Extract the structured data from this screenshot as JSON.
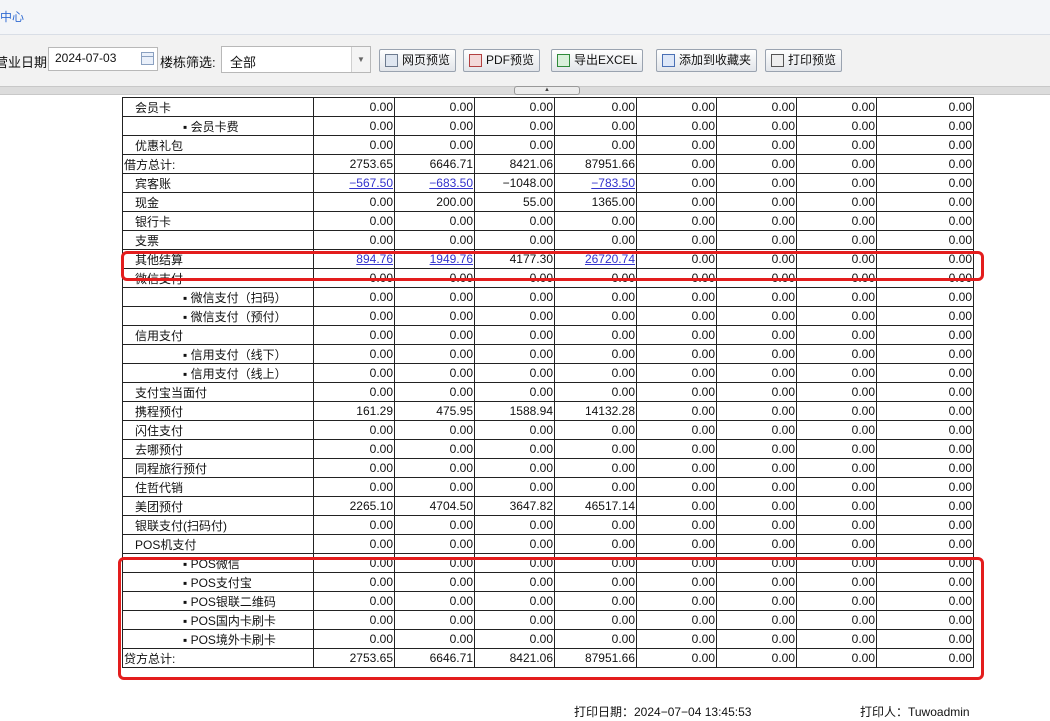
{
  "header": {
    "active_tab": "中心"
  },
  "toolbar": {
    "date_label": "营业日期",
    "date_value": "2024-07-03",
    "building_label": "楼栋筛选:",
    "building_value": "全部",
    "buttons": [
      "网页预览",
      "PDF预览",
      "导出EXCEL",
      "添加到收藏夹",
      "打印预览"
    ]
  },
  "table": {
    "rows": [
      {
        "name": "会员卡",
        "level": 1,
        "values": [
          "0.00",
          "0.00",
          "0.00",
          "0.00",
          "0.00",
          "0.00",
          "0.00",
          "0.00"
        ]
      },
      {
        "name": "▪ 会员卡费",
        "level": 2,
        "values": [
          "0.00",
          "0.00",
          "0.00",
          "0.00",
          "0.00",
          "0.00",
          "0.00",
          "0.00"
        ]
      },
      {
        "name": "优惠礼包",
        "level": 1,
        "values": [
          "0.00",
          "0.00",
          "0.00",
          "0.00",
          "0.00",
          "0.00",
          "0.00",
          "0.00"
        ]
      },
      {
        "name": "借方总计:",
        "level": 0,
        "values": [
          "2753.65",
          "6646.71",
          "8421.06",
          "87951.66",
          "0.00",
          "0.00",
          "0.00",
          "0.00"
        ]
      },
      {
        "name": "宾客账",
        "level": 1,
        "values": [
          "−567.50",
          "−683.50",
          "−1048.00",
          "−783.50",
          "0.00",
          "0.00",
          "0.00",
          "0.00"
        ],
        "links": [
          0,
          1,
          3
        ]
      },
      {
        "name": "现金",
        "level": 1,
        "values": [
          "0.00",
          "200.00",
          "55.00",
          "1365.00",
          "0.00",
          "0.00",
          "0.00",
          "0.00"
        ]
      },
      {
        "name": "银行卡",
        "level": 1,
        "values": [
          "0.00",
          "0.00",
          "0.00",
          "0.00",
          "0.00",
          "0.00",
          "0.00",
          "0.00"
        ]
      },
      {
        "name": "支票",
        "level": 1,
        "values": [
          "0.00",
          "0.00",
          "0.00",
          "0.00",
          "0.00",
          "0.00",
          "0.00",
          "0.00"
        ]
      },
      {
        "name": "其他结算",
        "level": 1,
        "values": [
          "894.76",
          "1949.76",
          "4177.30",
          "26720.74",
          "0.00",
          "0.00",
          "0.00",
          "0.00"
        ],
        "links": [
          0,
          1,
          3
        ]
      },
      {
        "name": "微信支付",
        "level": 1,
        "values": [
          "0.00",
          "0.00",
          "0.00",
          "0.00",
          "0.00",
          "0.00",
          "0.00",
          "0.00"
        ]
      },
      {
        "name": "▪ 微信支付（扫码）",
        "level": 2,
        "values": [
          "0.00",
          "0.00",
          "0.00",
          "0.00",
          "0.00",
          "0.00",
          "0.00",
          "0.00"
        ]
      },
      {
        "name": "▪ 微信支付（预付）",
        "level": 2,
        "values": [
          "0.00",
          "0.00",
          "0.00",
          "0.00",
          "0.00",
          "0.00",
          "0.00",
          "0.00"
        ]
      },
      {
        "name": "信用支付",
        "level": 1,
        "values": [
          "0.00",
          "0.00",
          "0.00",
          "0.00",
          "0.00",
          "0.00",
          "0.00",
          "0.00"
        ]
      },
      {
        "name": "▪ 信用支付（线下）",
        "level": 2,
        "values": [
          "0.00",
          "0.00",
          "0.00",
          "0.00",
          "0.00",
          "0.00",
          "0.00",
          "0.00"
        ]
      },
      {
        "name": "▪ 信用支付（线上）",
        "level": 2,
        "values": [
          "0.00",
          "0.00",
          "0.00",
          "0.00",
          "0.00",
          "0.00",
          "0.00",
          "0.00"
        ]
      },
      {
        "name": "支付宝当面付",
        "level": 1,
        "values": [
          "0.00",
          "0.00",
          "0.00",
          "0.00",
          "0.00",
          "0.00",
          "0.00",
          "0.00"
        ]
      },
      {
        "name": "携程预付",
        "level": 1,
        "values": [
          "161.29",
          "475.95",
          "1588.94",
          "14132.28",
          "0.00",
          "0.00",
          "0.00",
          "0.00"
        ]
      },
      {
        "name": "闪住支付",
        "level": 1,
        "values": [
          "0.00",
          "0.00",
          "0.00",
          "0.00",
          "0.00",
          "0.00",
          "0.00",
          "0.00"
        ]
      },
      {
        "name": "去哪预付",
        "level": 1,
        "values": [
          "0.00",
          "0.00",
          "0.00",
          "0.00",
          "0.00",
          "0.00",
          "0.00",
          "0.00"
        ]
      },
      {
        "name": "同程旅行预付",
        "level": 1,
        "values": [
          "0.00",
          "0.00",
          "0.00",
          "0.00",
          "0.00",
          "0.00",
          "0.00",
          "0.00"
        ]
      },
      {
        "name": "住哲代销",
        "level": 1,
        "values": [
          "0.00",
          "0.00",
          "0.00",
          "0.00",
          "0.00",
          "0.00",
          "0.00",
          "0.00"
        ]
      },
      {
        "name": "美团预付",
        "level": 1,
        "values": [
          "2265.10",
          "4704.50",
          "3647.82",
          "46517.14",
          "0.00",
          "0.00",
          "0.00",
          "0.00"
        ]
      },
      {
        "name": "银联支付(扫码付)",
        "level": 1,
        "values": [
          "0.00",
          "0.00",
          "0.00",
          "0.00",
          "0.00",
          "0.00",
          "0.00",
          "0.00"
        ]
      },
      {
        "name": "POS机支付",
        "level": 1,
        "values": [
          "0.00",
          "0.00",
          "0.00",
          "0.00",
          "0.00",
          "0.00",
          "0.00",
          "0.00"
        ]
      },
      {
        "name": "▪ POS微信",
        "level": 2,
        "values": [
          "0.00",
          "0.00",
          "0.00",
          "0.00",
          "0.00",
          "0.00",
          "0.00",
          "0.00"
        ]
      },
      {
        "name": "▪ POS支付宝",
        "level": 2,
        "values": [
          "0.00",
          "0.00",
          "0.00",
          "0.00",
          "0.00",
          "0.00",
          "0.00",
          "0.00"
        ]
      },
      {
        "name": "▪ POS银联二维码",
        "level": 2,
        "values": [
          "0.00",
          "0.00",
          "0.00",
          "0.00",
          "0.00",
          "0.00",
          "0.00",
          "0.00"
        ]
      },
      {
        "name": "▪ POS国内卡刷卡",
        "level": 2,
        "values": [
          "0.00",
          "0.00",
          "0.00",
          "0.00",
          "0.00",
          "0.00",
          "0.00",
          "0.00"
        ]
      },
      {
        "name": "▪ POS境外卡刷卡",
        "level": 2,
        "values": [
          "0.00",
          "0.00",
          "0.00",
          "0.00",
          "0.00",
          "0.00",
          "0.00",
          "0.00"
        ]
      },
      {
        "name": "贷方总计:",
        "level": 0,
        "values": [
          "2753.65",
          "6646.71",
          "8421.06",
          "87951.66",
          "0.00",
          "0.00",
          "0.00",
          "0.00"
        ]
      }
    ]
  },
  "footer": {
    "print_date": "打印日期：2024−07−04 13:45:53",
    "printer": "打印人：Tuwoadmin"
  },
  "colors": {
    "highlight": "#e31d1d",
    "link": "#3333cc",
    "accent": "#2f6ad2"
  }
}
